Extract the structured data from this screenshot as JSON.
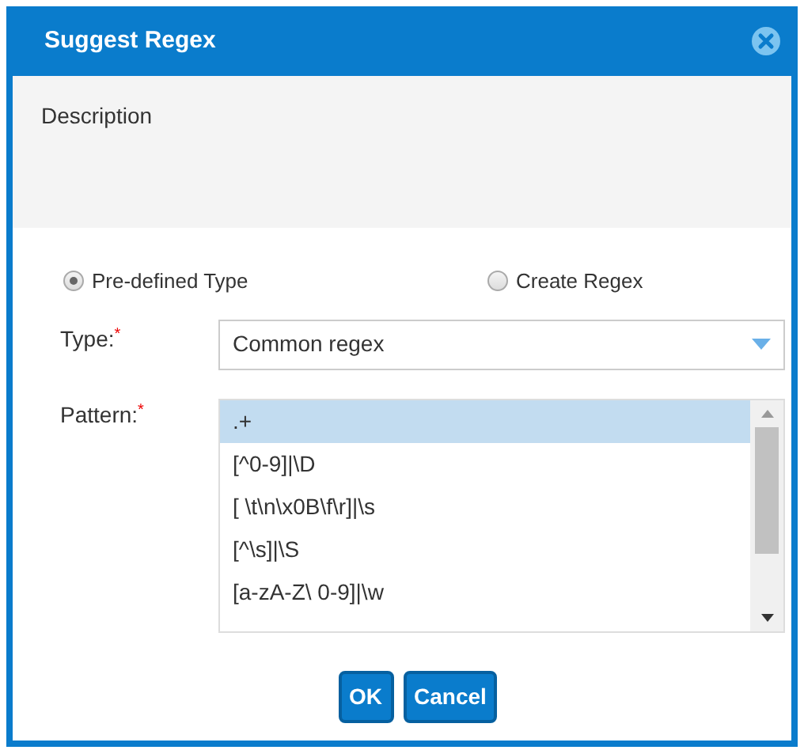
{
  "dialog": {
    "title": "Suggest Regex",
    "description": "Description"
  },
  "mode_options": [
    {
      "label": "Pre-defined Type",
      "selected": true
    },
    {
      "label": "Create Regex",
      "selected": false
    }
  ],
  "type_field": {
    "label": "Type:",
    "required_mark": "*",
    "value": "Common regex"
  },
  "pattern_field": {
    "label": "Pattern:",
    "required_mark": "*",
    "items": [
      {
        "text": ".+",
        "selected": true
      },
      {
        "text": "[^0-9]|\\D",
        "selected": false
      },
      {
        "text": "[ \\t\\n\\x0B\\f\\r]|\\s",
        "selected": false
      },
      {
        "text": "[^\\s]|\\S",
        "selected": false
      },
      {
        "text": "[a-zA-Z\\ 0-9]|\\w",
        "selected": false
      }
    ]
  },
  "buttons": [
    {
      "label": "OK"
    },
    {
      "label": "Cancel"
    }
  ]
}
